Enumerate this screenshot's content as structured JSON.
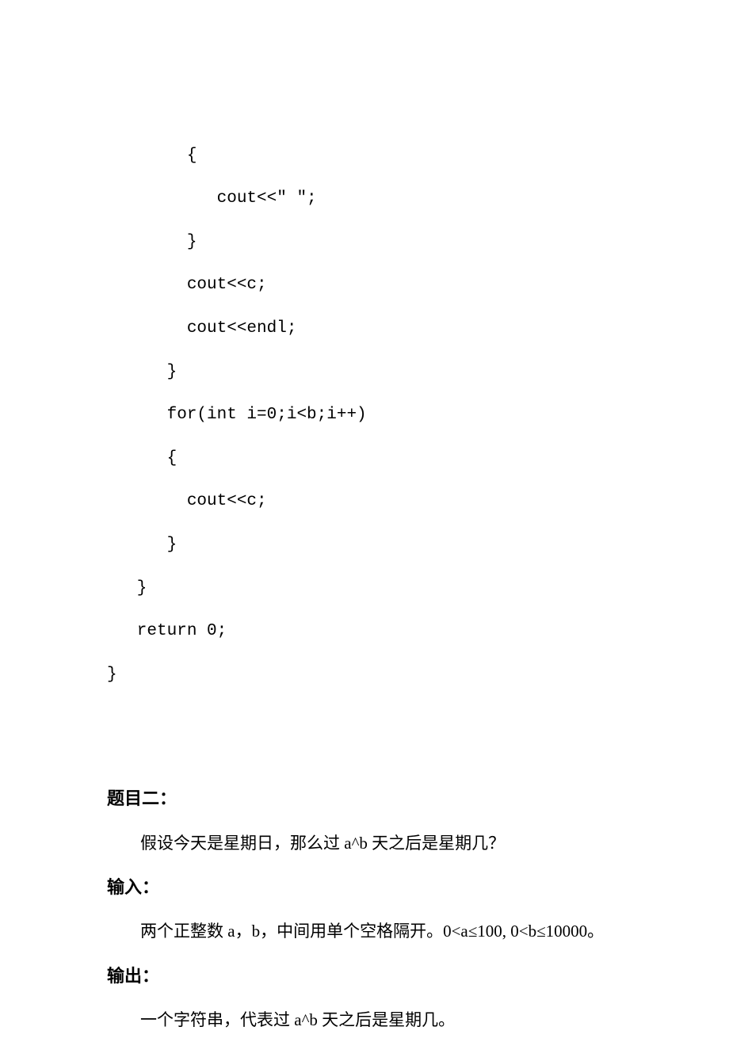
{
  "code": {
    "l1": "        {",
    "l2": "           cout<<\" \";",
    "l3": "        }",
    "l4": "        cout<<c;",
    "l5": "        cout<<endl;",
    "l6": "      }",
    "l7": "      for(int i=0;i<b;i++)",
    "l8": "      {",
    "l9": "        cout<<c;",
    "l10": "      }",
    "l11": "   }",
    "l12": "   return 0;",
    "l13": "}"
  },
  "problem2": {
    "title": "题目二：",
    "desc": "假设今天是星期日，那么过 a^b 天之后是星期几？",
    "input_label": "输入：",
    "input_desc": "两个正整数 a，b，中间用单个空格隔开。0<a≤100, 0<b≤10000。",
    "output_label": "输出：",
    "output_desc": "一个字符串，代表过 a^b 天之后是星期几。"
  }
}
